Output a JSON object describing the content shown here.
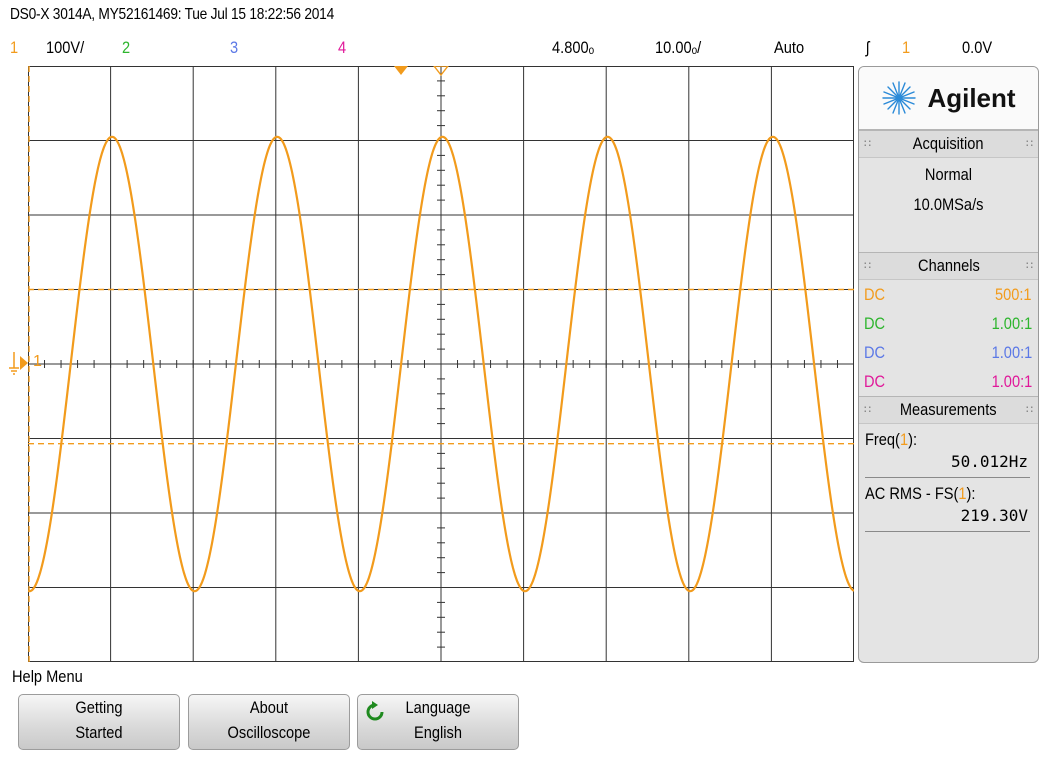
{
  "header": {
    "title": "DS0-X 3014A, MY52161469: Tue Jul 15 18:22:56 2014"
  },
  "status": {
    "ch1_num": "1",
    "ch1_scale": "100V/",
    "ch2_num": "2",
    "ch3_num": "3",
    "ch4_num": "4",
    "time_delay": "4.800ₒ",
    "time_scale": "10.00ₒ/",
    "trigger_mode": "Auto",
    "trigger_slope": "ʃ",
    "trigger_source": "1",
    "trigger_level": "0.0V"
  },
  "panel": {
    "brand": "Agilent",
    "acquisition": {
      "title": "Acquisition",
      "mode": "Normal",
      "rate": "10.0MSa/s"
    },
    "channels": {
      "title": "Channels",
      "rows": [
        {
          "coupling": "DC",
          "probe": "500:1",
          "color": "#f29b1c"
        },
        {
          "coupling": "DC",
          "probe": "1.00:1",
          "color": "#2db52d"
        },
        {
          "coupling": "DC",
          "probe": "1.00:1",
          "color": "#5b78e6"
        },
        {
          "coupling": "DC",
          "probe": "1.00:1",
          "color": "#e0189a"
        }
      ]
    },
    "measurements": {
      "title": "Measurements",
      "freq_label_a": "Freq(",
      "freq_label_ch": "1",
      "freq_label_b": "):",
      "freq_value": "50.012Hz",
      "rms_label_a": "AC RMS - FS(",
      "rms_label_ch": "1",
      "rms_label_b": "):",
      "rms_value": "219.30V"
    }
  },
  "scope": {
    "channel_marker": "1",
    "trace_color": "#f29b1c",
    "ch_colors": {
      "ch1": "#f29b1c",
      "ch2": "#2db52d",
      "ch3": "#5b78e6",
      "ch4": "#e0189a"
    }
  },
  "softkeys": {
    "menu_title": "Help Menu",
    "getting_started_1": "Getting",
    "getting_started_2": "Started",
    "about_1": "About",
    "about_2": "Oscilloscope",
    "language_1": "Language",
    "language_2": "English"
  }
}
